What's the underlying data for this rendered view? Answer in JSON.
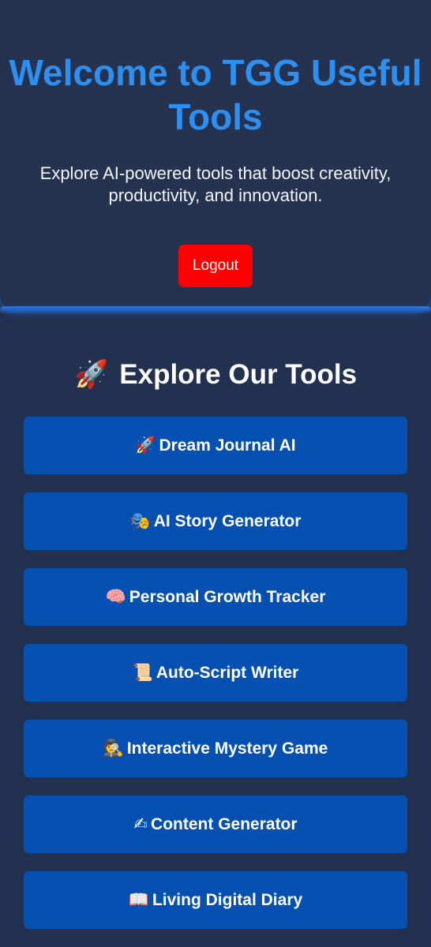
{
  "hero": {
    "title": "Welcome to TGG Useful Tools",
    "subtitle": "Explore AI-powered tools that boost creativity, productivity, and innovation.",
    "logout_label": "Logout",
    "colors": {
      "title": "#2d8ff0",
      "logout_bg": "#ff0000"
    }
  },
  "tools": {
    "heading_icon": "🚀",
    "heading": "Explore Our Tools",
    "button_color": "#0550b0",
    "items": [
      {
        "icon": "🚀",
        "icon_name": "rocket-icon",
        "label": "Dream Journal AI"
      },
      {
        "icon": "🎭",
        "icon_name": "theater-masks-icon",
        "label": "AI Story Generator"
      },
      {
        "icon": "🧠",
        "icon_name": "brain-icon",
        "label": "Personal Growth Tracker"
      },
      {
        "icon": "📜",
        "icon_name": "scroll-icon",
        "label": "Auto-Script Writer"
      },
      {
        "icon": "🕵",
        "icon_name": "detective-icon",
        "label": "Interactive Mystery Game"
      },
      {
        "icon": "✍",
        "icon_name": "writing-hand-icon",
        "label": "Content Generator"
      },
      {
        "icon": "📖",
        "icon_name": "open-book-icon",
        "label": "Living Digital Diary"
      }
    ]
  }
}
